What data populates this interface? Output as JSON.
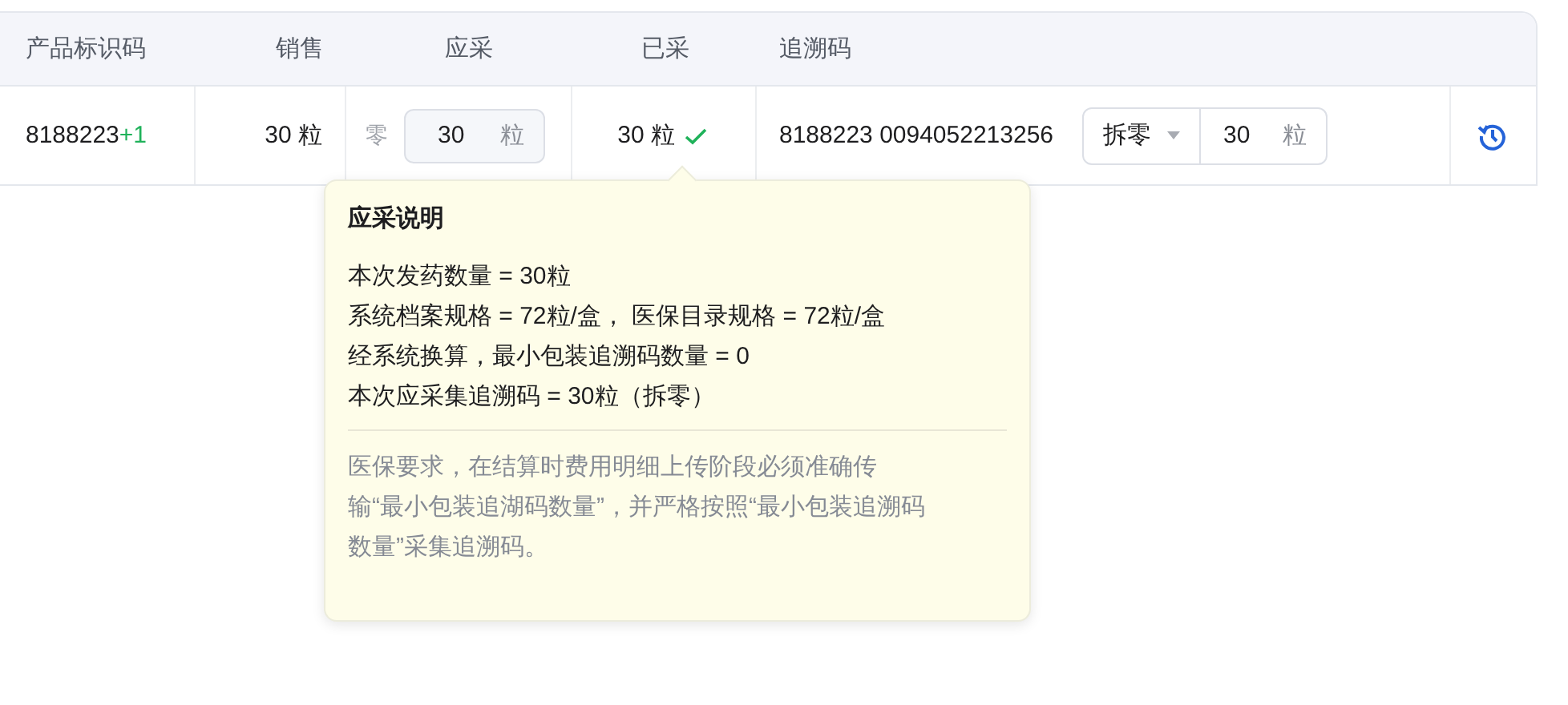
{
  "table": {
    "columns": [
      "产品标识码",
      "销售",
      "应采",
      "已采",
      "追溯码"
    ],
    "row": {
      "product_code": "8188223",
      "product_extra": "+1",
      "sales": "30 粒",
      "required_prefix": "零",
      "required_value": "30",
      "required_unit": "粒",
      "collected": "30 粒",
      "collected_ok": true,
      "trace_code": "8188223 0094052213256",
      "split_select": "拆零",
      "split_value": "30",
      "split_unit": "粒"
    }
  },
  "tooltip": {
    "title": "应采说明",
    "lines": [
      "本次发药数量 = 30粒",
      "系统档案规格 = 72粒/盒， 医保目录规格 = 72粒/盒",
      "经系统换算，最小包装追溯码数量 = 0",
      "本次应采集追溯码 = 30粒（拆零）"
    ],
    "note": "医保要求，在结算时费用明细上传阶段必须准确传输“最小包装追湖码数量”，并严格按照“最小包装追溯码数量”采集追溯码。"
  }
}
